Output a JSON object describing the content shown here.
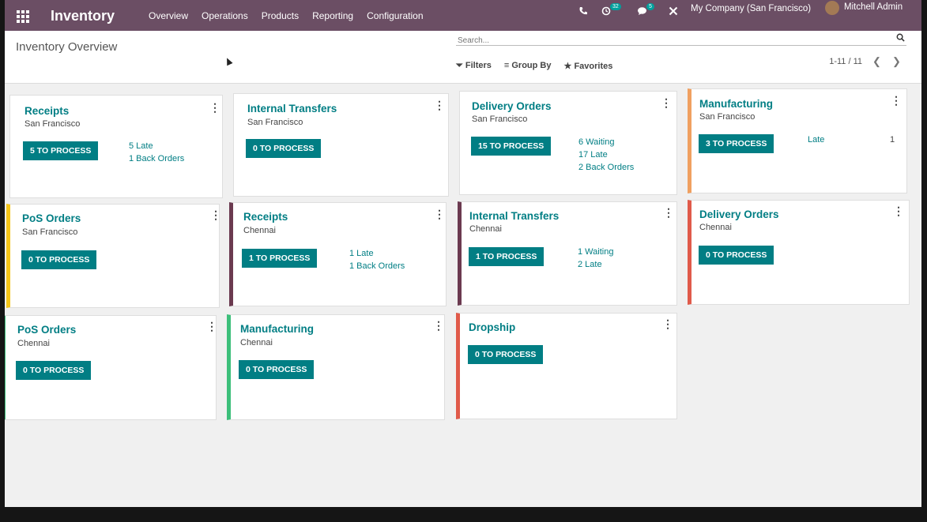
{
  "navbar": {
    "app_title": "Inventory",
    "menu": [
      "Overview",
      "Operations",
      "Products",
      "Reporting",
      "Configuration"
    ],
    "phone_icon": "phone-icon",
    "activity_count": "32",
    "messages_count": "5",
    "company": "My Company (San Francisco)",
    "user": "Mitchell Admin"
  },
  "control": {
    "breadcrumb": "Inventory Overview",
    "search_placeholder": "Search...",
    "filters": "Filters",
    "group_by": "Group By",
    "favorites": "Favorites",
    "pager": "1-11 / 11"
  },
  "cards": [
    {
      "title": "Receipts",
      "sub": "San Francisco",
      "button": "5 TO PROCESS",
      "stats": [
        "5 Late",
        "1 Back Orders"
      ]
    },
    {
      "title": "Internal Transfers",
      "sub": "San Francisco",
      "button": "0 TO PROCESS",
      "stats": []
    },
    {
      "title": "Delivery Orders",
      "sub": "San Francisco",
      "button": "15 TO PROCESS",
      "stats": [
        "6 Waiting",
        "17 Late",
        "2 Back Orders"
      ]
    },
    {
      "title": "Manufacturing",
      "sub": "San Francisco",
      "button": "3 TO PROCESS",
      "stats": [
        "Late"
      ],
      "count": "1"
    },
    {
      "title": "PoS Orders",
      "sub": "San Francisco",
      "button": "0 TO PROCESS",
      "stats": []
    },
    {
      "title": "Receipts",
      "sub": "Chennai",
      "button": "1 TO PROCESS",
      "stats": [
        "1 Late",
        "1 Back Orders"
      ]
    },
    {
      "title": "Internal Transfers",
      "sub": "Chennai",
      "button": "1 TO PROCESS",
      "stats": [
        "1 Waiting",
        "2 Late"
      ]
    },
    {
      "title": "Delivery Orders",
      "sub": "Chennai",
      "button": "0 TO PROCESS",
      "stats": []
    },
    {
      "title": "PoS Orders",
      "sub": "Chennai",
      "button": "0 TO PROCESS",
      "stats": []
    },
    {
      "title": "Manufacturing",
      "sub": "Chennai",
      "button": "0 TO PROCESS",
      "stats": []
    },
    {
      "title": "Dropship",
      "sub": "",
      "button": "0 TO PROCESS",
      "stats": []
    }
  ],
  "colors": {
    "navbar": "#6b4e64",
    "primary": "#017e84",
    "bar_orange": "#f0a060",
    "bar_yellow": "#f5c518",
    "bar_purple": "#6b3a50",
    "bar_red": "#e05a4a",
    "bar_green": "#3cbf7a"
  }
}
